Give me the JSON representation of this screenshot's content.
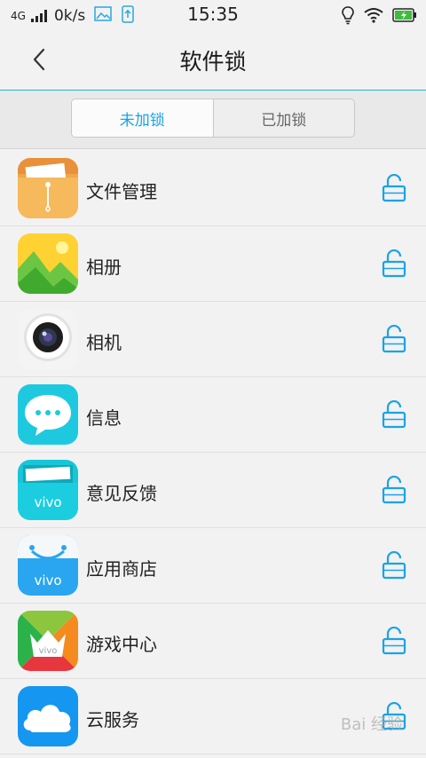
{
  "status_bar": {
    "network": "4G",
    "speed": "0k/s",
    "time": "15:35"
  },
  "header": {
    "title": "软件锁",
    "back_icon": "chevron-left-icon"
  },
  "tabs": [
    {
      "label": "未加锁",
      "active": true
    },
    {
      "label": "已加锁",
      "active": false
    }
  ],
  "apps": [
    {
      "name": "文件管理",
      "icon": "file-manager-icon",
      "locked": false
    },
    {
      "name": "相册",
      "icon": "gallery-icon",
      "locked": false
    },
    {
      "name": "相机",
      "icon": "camera-icon",
      "locked": false
    },
    {
      "name": "信息",
      "icon": "messages-icon",
      "locked": false
    },
    {
      "name": "意见反馈",
      "icon": "feedback-icon",
      "locked": false
    },
    {
      "name": "应用商店",
      "icon": "app-store-icon",
      "locked": false
    },
    {
      "name": "游戏中心",
      "icon": "game-center-icon",
      "locked": false
    },
    {
      "name": "云服务",
      "icon": "cloud-service-icon",
      "locked": false
    }
  ],
  "icon_brand_text": "vivo",
  "colors": {
    "accent": "#1aa3e6",
    "lock_icon": "#1aa3e6"
  },
  "watermark": "Bai 经验"
}
